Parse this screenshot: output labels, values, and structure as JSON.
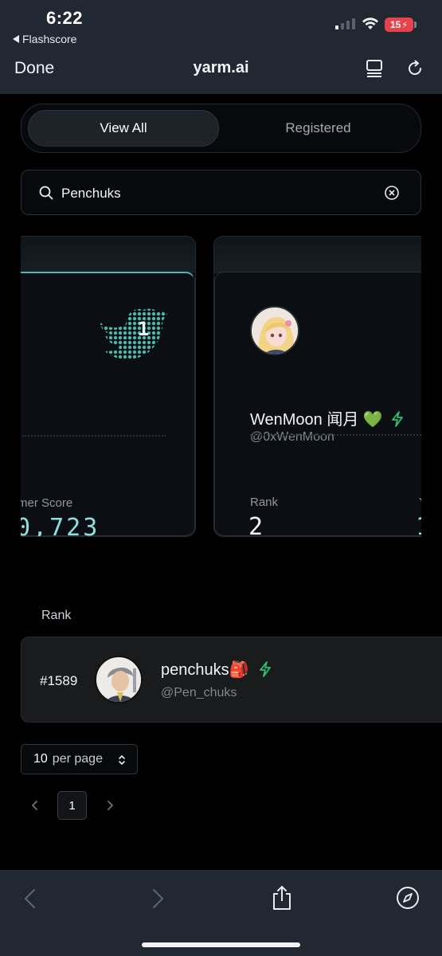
{
  "status_bar": {
    "time": "6:22",
    "back_app": "Flashscore",
    "battery": "15"
  },
  "nav": {
    "done_label": "Done",
    "title": "yarm.ai"
  },
  "tabs": {
    "view_all": "View All",
    "registered": "Registered",
    "selected": "View All"
  },
  "search": {
    "value": "Penchuks"
  },
  "cards": [
    {
      "score_label": "mer Score",
      "score_value": "0,723"
    },
    {
      "name": "WenMoon 闻月 💚",
      "handle": "@0xWenMoon",
      "rank_label": "Rank",
      "rank_value": "2",
      "next_col_fragment": "Y",
      "next_value_fragment": "1"
    }
  ],
  "rank_list": {
    "header": "Rank",
    "rows": [
      {
        "rank": "#1589",
        "name": "penchuks🎒",
        "handle": "@Pen_chuks"
      }
    ]
  },
  "pagination": {
    "per_page_value": "10",
    "per_page_label": "per page",
    "current_page": "1"
  },
  "colors": {
    "accent_teal": "#53b5b5",
    "verified_green": "#2fbf71"
  },
  "icons": {
    "tab_icon": "tabs-icon",
    "reload_icon": "reload-icon",
    "search_icon": "search-icon",
    "clear_icon": "clear-icon",
    "bolt_icon": "lightning-icon",
    "share_icon": "share-icon",
    "compass_icon": "compass-icon"
  }
}
